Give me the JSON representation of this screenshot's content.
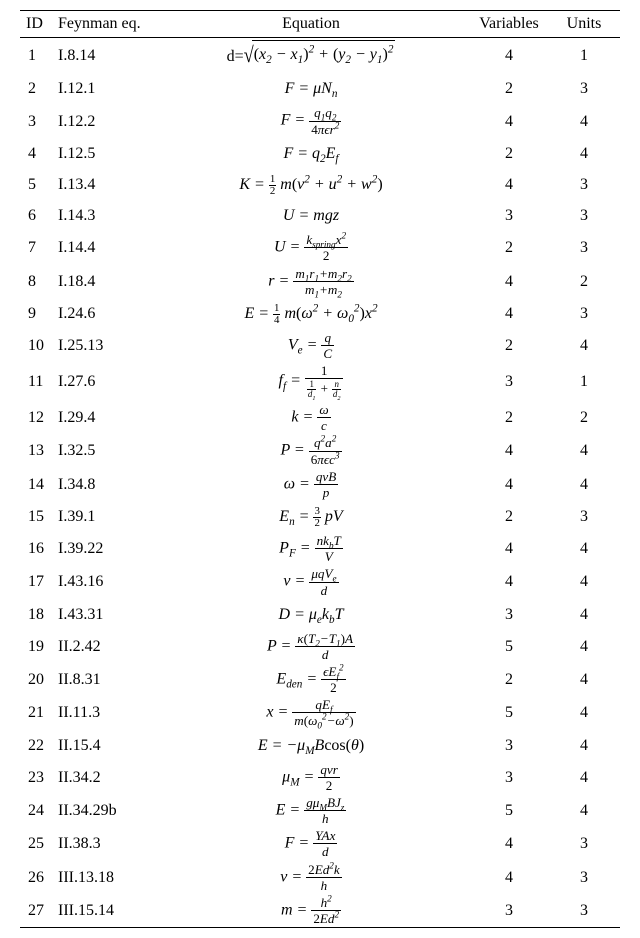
{
  "headers": {
    "id": "ID",
    "feynman": "Feynman eq.",
    "equation": "Equation",
    "variables": "Variables",
    "units": "Units"
  },
  "rows": [
    {
      "id": "1",
      "fe": "I.8.14",
      "eq": "d=\\sqrt{(x_2-x_1)^2+(y_2-y_1)^2}",
      "vars": "4",
      "units": "1"
    },
    {
      "id": "2",
      "fe": "I.12.1",
      "eq": "F=\\mu N_n",
      "vars": "2",
      "units": "3"
    },
    {
      "id": "3",
      "fe": "I.12.2",
      "eq": "F=\\frac{q_1 q_2}{4\\pi\\epsilon r^2}",
      "vars": "4",
      "units": "4"
    },
    {
      "id": "4",
      "fe": "I.12.5",
      "eq": "F=q_2 E_f",
      "vars": "2",
      "units": "4"
    },
    {
      "id": "5",
      "fe": "I.13.4",
      "eq": "K=\\tfrac{1}{2}m(v^2+u^2+w^2)",
      "vars": "4",
      "units": "3"
    },
    {
      "id": "6",
      "fe": "I.14.3",
      "eq": "U=mgz",
      "vars": "3",
      "units": "3"
    },
    {
      "id": "7",
      "fe": "I.14.4",
      "eq": "U=\\frac{k_{spring} x^2}{2}",
      "vars": "2",
      "units": "3"
    },
    {
      "id": "8",
      "fe": "I.18.4",
      "eq": "r=\\frac{m_1 r_1 + m_2 r_2}{m_1+m_2}",
      "vars": "4",
      "units": "2"
    },
    {
      "id": "9",
      "fe": "I.24.6",
      "eq": "E=\\tfrac{1}{4}m(\\omega^2+\\omega_0^2)x^2",
      "vars": "4",
      "units": "3"
    },
    {
      "id": "10",
      "fe": "I.25.13",
      "eq": "V_e=\\frac{q}{C}",
      "vars": "2",
      "units": "4"
    },
    {
      "id": "11",
      "fe": "I.27.6",
      "eq": "f_f=\\frac{1}{\\frac{1}{d_1}+\\frac{n}{d_2}}",
      "vars": "3",
      "units": "1"
    },
    {
      "id": "12",
      "fe": "I.29.4",
      "eq": "k=\\frac{\\omega}{c}",
      "vars": "2",
      "units": "2"
    },
    {
      "id": "13",
      "fe": "I.32.5",
      "eq": "P=\\frac{q^2 a^2}{6\\pi\\epsilon c^3}",
      "vars": "4",
      "units": "4"
    },
    {
      "id": "14",
      "fe": "I.34.8",
      "eq": "\\omega=\\frac{qvB}{p}",
      "vars": "4",
      "units": "4"
    },
    {
      "id": "15",
      "fe": "I.39.1",
      "eq": "E_n=\\tfrac{3}{2}pV",
      "vars": "2",
      "units": "3"
    },
    {
      "id": "16",
      "fe": "I.39.22",
      "eq": "P_F=\\frac{n k_b T}{V}",
      "vars": "4",
      "units": "4"
    },
    {
      "id": "17",
      "fe": "I.43.16",
      "eq": "v=\\frac{\\mu q V_e}{d}",
      "vars": "4",
      "units": "4"
    },
    {
      "id": "18",
      "fe": "I.43.31",
      "eq": "D=\\mu_e k_b T",
      "vars": "3",
      "units": "4"
    },
    {
      "id": "19",
      "fe": "II.2.42",
      "eq": "P=\\frac{\\kappa(T_2-T_1)A}{d}",
      "vars": "5",
      "units": "4"
    },
    {
      "id": "20",
      "fe": "II.8.31",
      "eq": "E_{den}=\\frac{\\epsilon E_f^2}{2}",
      "vars": "2",
      "units": "4"
    },
    {
      "id": "21",
      "fe": "II.11.3",
      "eq": "x=\\frac{q E_f}{m(\\omega_0^2-\\omega^2)}",
      "vars": "5",
      "units": "4"
    },
    {
      "id": "22",
      "fe": "II.15.4",
      "eq": "E=-\\mu_M B\\cos(\\theta)",
      "vars": "3",
      "units": "4"
    },
    {
      "id": "23",
      "fe": "II.34.2",
      "eq": "\\mu_M=\\frac{qvr}{2}",
      "vars": "3",
      "units": "4"
    },
    {
      "id": "24",
      "fe": "II.34.29b",
      "eq": "E=\\frac{g\\mu_M B J_z}{h}",
      "vars": "5",
      "units": "4"
    },
    {
      "id": "25",
      "fe": "II.38.3",
      "eq": "F=\\frac{YAx}{d}",
      "vars": "4",
      "units": "3"
    },
    {
      "id": "26",
      "fe": "III.13.18",
      "eq": "v=\\frac{2Ed^2 k}{h}",
      "vars": "4",
      "units": "3"
    },
    {
      "id": "27",
      "fe": "III.15.14",
      "eq": "m=\\frac{h^2}{2Ed^2}",
      "vars": "3",
      "units": "3"
    }
  ]
}
